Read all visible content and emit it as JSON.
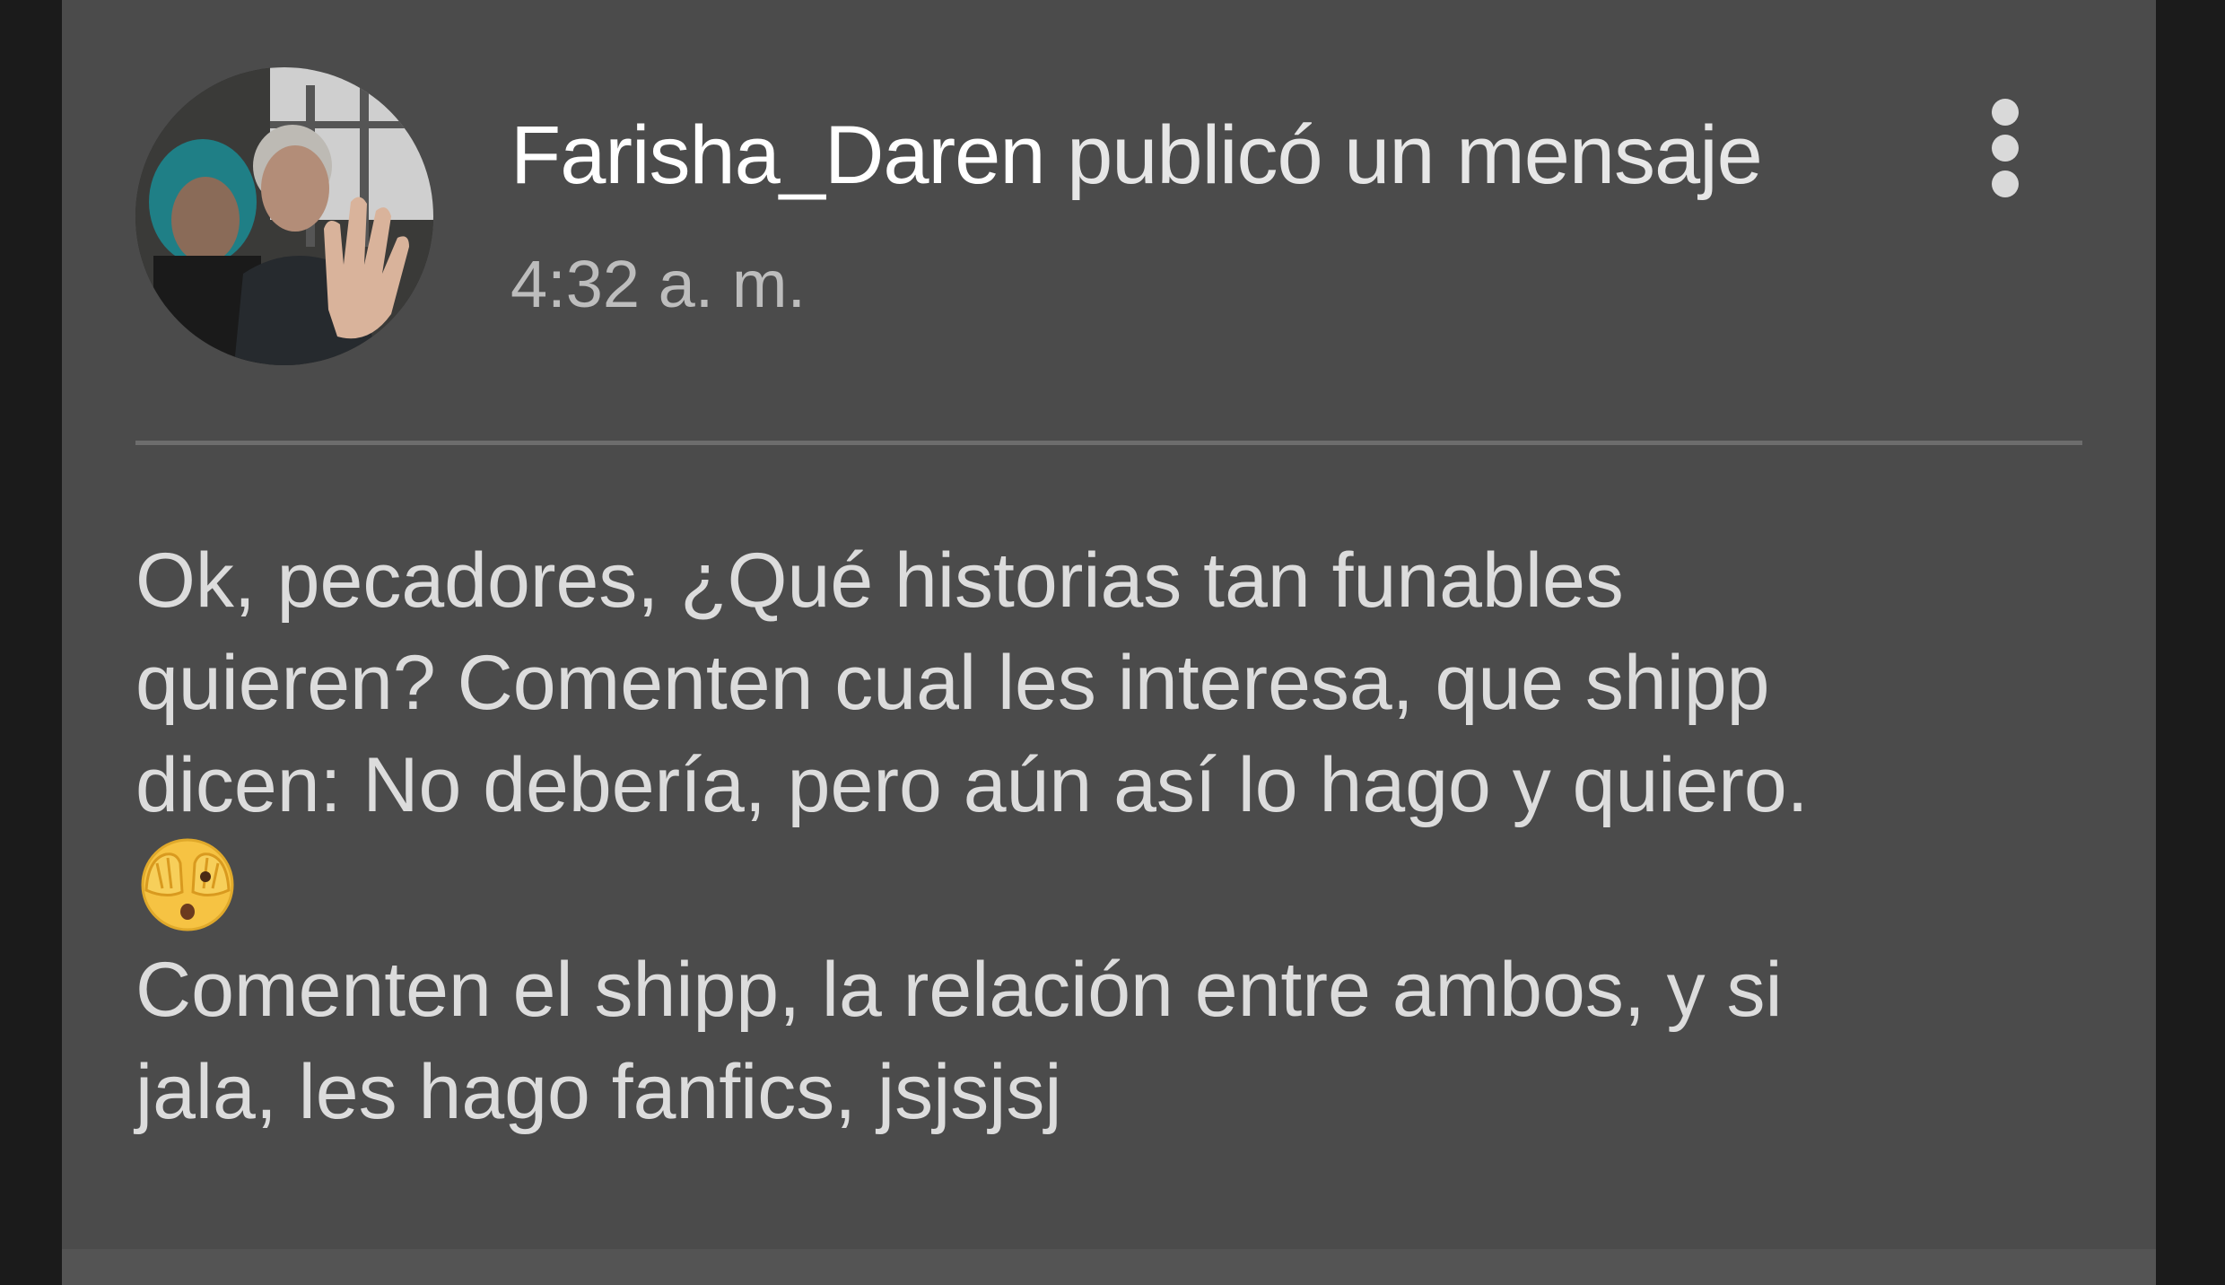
{
  "post": {
    "author": "Farisha_Daren",
    "action": " publicó un mensaje",
    "timestamp": "4:32 a. m.",
    "menu_icon": "more-vertical-icon",
    "avatar_icon": "user-avatar-photo",
    "body_lines_1": [
      "Ok, pecadores, ¿Qué historias tan funables",
      "quieren? Comenten cual les interesa, que shipp",
      "dicen: No debería, pero aún así lo hago y quiero."
    ],
    "emoji": "face-with-peeking-eye-emoji",
    "body_lines_2": [
      "Comenten el shipp, la relación entre ambos, y si",
      "jala, les hago fanfics, jsjsjsj"
    ]
  },
  "colors": {
    "background": "#1b1b1b",
    "card": "#4b4b4b",
    "author_text": "#ffffff",
    "timestamp_text": "#bdbdbd",
    "body_text": "#dcdcdc"
  }
}
